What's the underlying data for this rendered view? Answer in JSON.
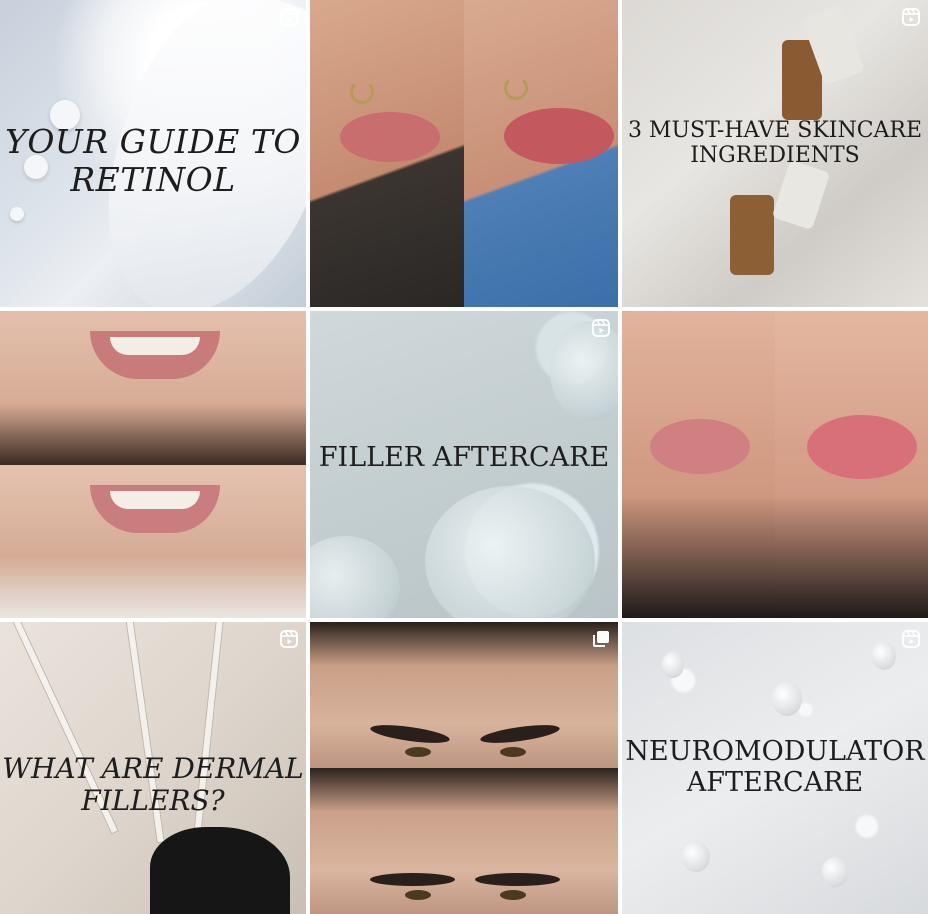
{
  "grid": {
    "tiles": [
      {
        "caption": "YOUR GUIDE TO RETINOL",
        "caption_lines": [
          "YOUR GUIDE TO",
          "RETINOL"
        ],
        "badge": "reel-icon"
      },
      {
        "caption": "",
        "badge": ""
      },
      {
        "caption": "3 MUST-HAVE SKINCARE INGREDIENTS",
        "caption_lines": [
          "3 MUST-HAVE SKINCARE",
          "INGREDIENTS"
        ],
        "badge": "reel-icon"
      },
      {
        "caption": "",
        "badge": ""
      },
      {
        "caption": "FILLER AFTERCARE",
        "caption_lines": [
          "FILLER AFTERCARE"
        ],
        "badge": "reel-icon"
      },
      {
        "caption": "",
        "badge": ""
      },
      {
        "caption": "WHAT ARE DERMAL FILLERS?",
        "caption_lines": [
          "WHAT ARE DERMAL",
          "FILLERS?"
        ],
        "badge": "reel-icon"
      },
      {
        "caption": "",
        "badge": "carousel-icon"
      },
      {
        "caption": "NEUROMODULATOR AFTERCARE",
        "caption_lines": [
          "NEUROMODULATOR",
          "AFTERCARE"
        ],
        "badge": "reel-icon"
      }
    ]
  },
  "colors": {
    "badge": "#ffffff",
    "caption": "#1d1d1d"
  }
}
